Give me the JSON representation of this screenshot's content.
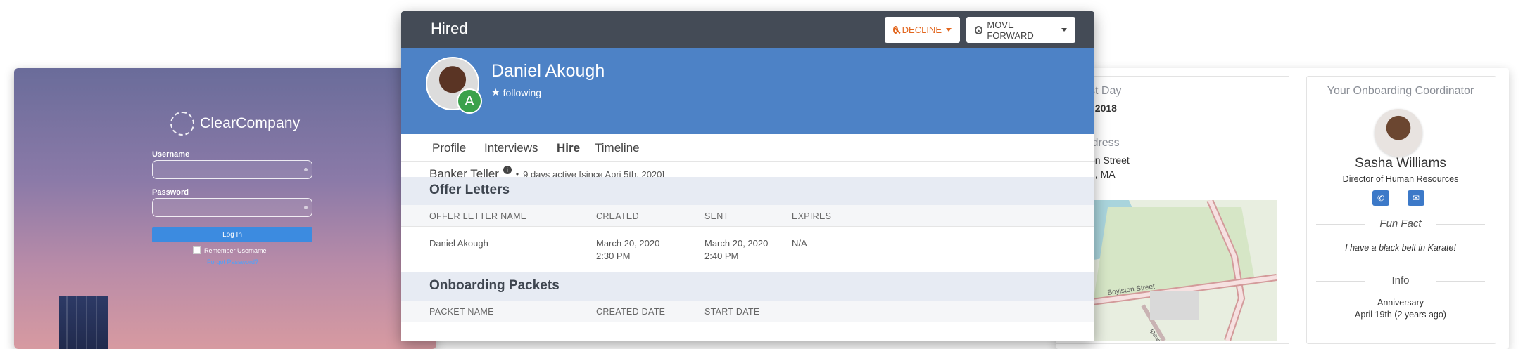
{
  "login": {
    "logo_text": "ClearCompany",
    "username_label": "Username",
    "password_label": "Password",
    "login_button": "Log In",
    "remember_label": "Remember Username",
    "forgot_link": "Forgot Password?"
  },
  "first_day": {
    "title": "st Day",
    "value": ", 2018",
    "address_title": "ldress",
    "address_line1": "on Street",
    "address_line2": "n, MA",
    "map_street_label": "Boylston Street",
    "map_street_label2": "Ipswich St"
  },
  "coordinator": {
    "title": "Your Onboarding Coordinator",
    "name": "Sasha Williams",
    "role": "Director of Human Resources",
    "fun_fact_title": "Fun Fact",
    "fun_fact_text": "I have a black belt in Karate!",
    "info_title": "Info",
    "info_label": "Anniversary",
    "info_value": "April 19th (2 years ago)"
  },
  "modal": {
    "title": "Hired",
    "decline_label": "DECLINE",
    "move_forward_label": "MOVE FORWARD",
    "candidate_name": "Daniel Akough",
    "avatar_badge": "A",
    "following_label": "following",
    "tabs": [
      {
        "label": "Profile"
      },
      {
        "label": "Interviews"
      },
      {
        "label": "Hire"
      },
      {
        "label": "Timeline"
      }
    ],
    "job_title": "Banker Teller",
    "job_sep": "•",
    "job_status": "9 days active [since Apri 5th, 2020]",
    "offer_letters": {
      "title": "Offer Letters",
      "columns": [
        "OFFER LETTER NAME",
        "CREATED",
        "SENT",
        "EXPIRES"
      ],
      "rows": [
        {
          "name": "Daniel Akough",
          "created_date": "March 20, 2020",
          "created_time": "2:30 PM",
          "sent_date": "March 20, 2020",
          "sent_time": "2:40 PM",
          "expires": "N/A"
        }
      ]
    },
    "onboarding_packets": {
      "title": "Onboarding Packets",
      "columns": [
        "PACKET NAME",
        "CREATED DATE",
        "START DATE"
      ]
    }
  },
  "colors": {
    "header_bg": "#444b56",
    "profile_band": "#4d82c6",
    "decline": "#e2661e",
    "badge_green": "#3aa14b",
    "section_bg": "#e7ebf3"
  }
}
